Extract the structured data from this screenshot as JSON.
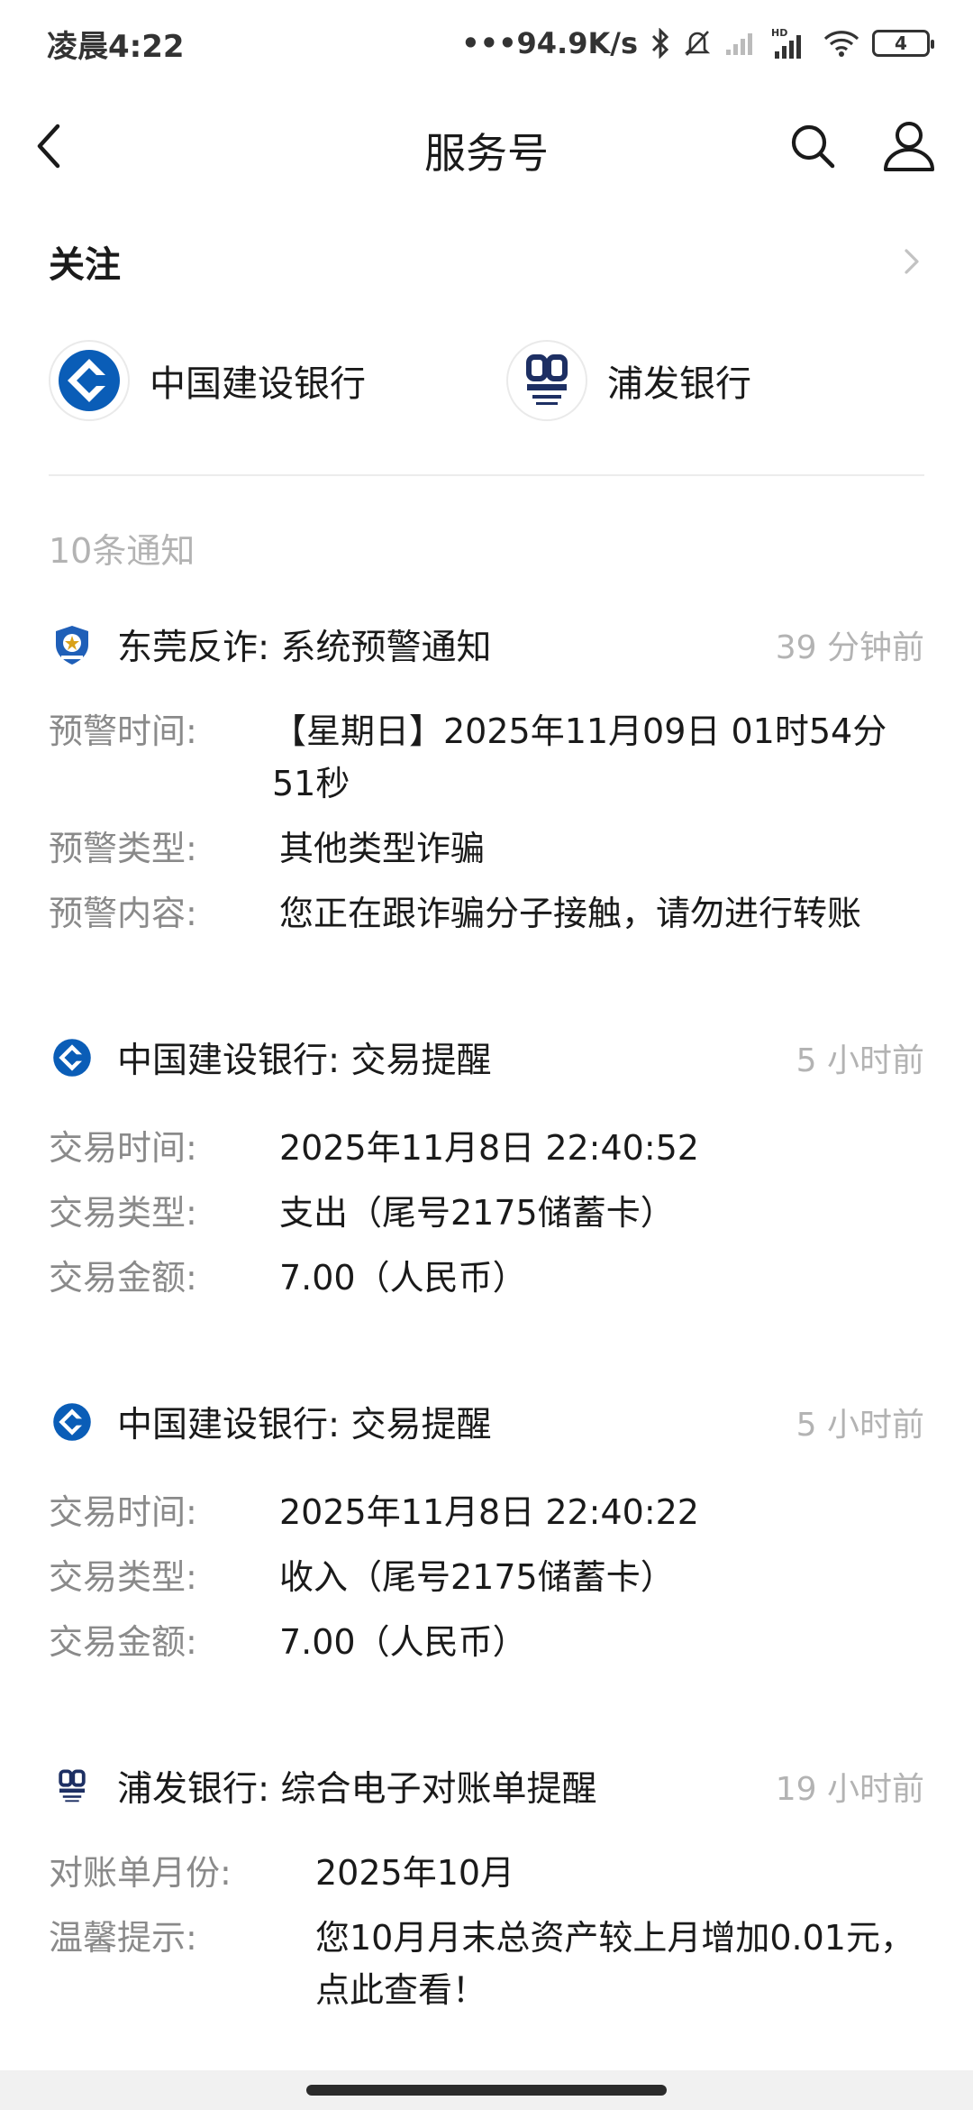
{
  "status_bar": {
    "time": "凌晨4:22",
    "network_speed": "•••94.9K/s",
    "battery": "4",
    "icons": [
      "bluetooth-icon",
      "mute-icon",
      "signal-icon",
      "hd-signal-icon",
      "wifi-icon",
      "battery-icon"
    ]
  },
  "header": {
    "title": "服务号",
    "icons": [
      "back-icon",
      "search-icon",
      "user-icon"
    ]
  },
  "follow": {
    "title": "关注",
    "accounts": [
      {
        "name": "中国建设银行",
        "logo": "ccb-logo"
      },
      {
        "name": "浦发银行",
        "logo": "spdb-logo"
      }
    ]
  },
  "notice_count": "10条通知",
  "notices": [
    {
      "source_logo": "police-badge-icon",
      "title": "东莞反诈:  系统预警通知",
      "time": "39 分钟前",
      "rows": [
        {
          "k": "预警时间:",
          "v": "【星期日】2025年11月09日 01时54分51秒"
        },
        {
          "k": "预警类型:",
          "v": "其他类型诈骗"
        },
        {
          "k": "预警内容:",
          "v": "您正在跟诈骗分子接触，请勿进行转账"
        }
      ]
    },
    {
      "source_logo": "ccb-logo",
      "title": "中国建设银行:  交易提醒",
      "time": "5 小时前",
      "rows": [
        {
          "k": "交易时间:",
          "v": "2025年11月8日 22:40:52"
        },
        {
          "k": "交易类型:",
          "v": "支出（尾号2175储蓄卡）"
        },
        {
          "k": "交易金额:",
          "v": "7.00（人民币）"
        }
      ]
    },
    {
      "source_logo": "ccb-logo",
      "title": "中国建设银行:  交易提醒",
      "time": "5 小时前",
      "rows": [
        {
          "k": "交易时间:",
          "v": "2025年11月8日 22:40:22"
        },
        {
          "k": "交易类型:",
          "v": "收入（尾号2175储蓄卡）"
        },
        {
          "k": "交易金额:",
          "v": "7.00（人民币）"
        }
      ]
    },
    {
      "source_logo": "spdb-logo",
      "title": "浦发银行:  综合电子对账单提醒",
      "time": "19 小时前",
      "rows": [
        {
          "k": "对账单月份:",
          "v": "2025年10月"
        },
        {
          "k": "温馨提示:",
          "v": "您10月月末总资产较上月增加0.01元，点此查看！"
        }
      ]
    }
  ],
  "colors": {
    "ccb_blue": "#0a5db7",
    "spdb_navy": "#1d2f63",
    "muted_text": "#8a8a8a",
    "time_text": "#b3b3b3"
  }
}
